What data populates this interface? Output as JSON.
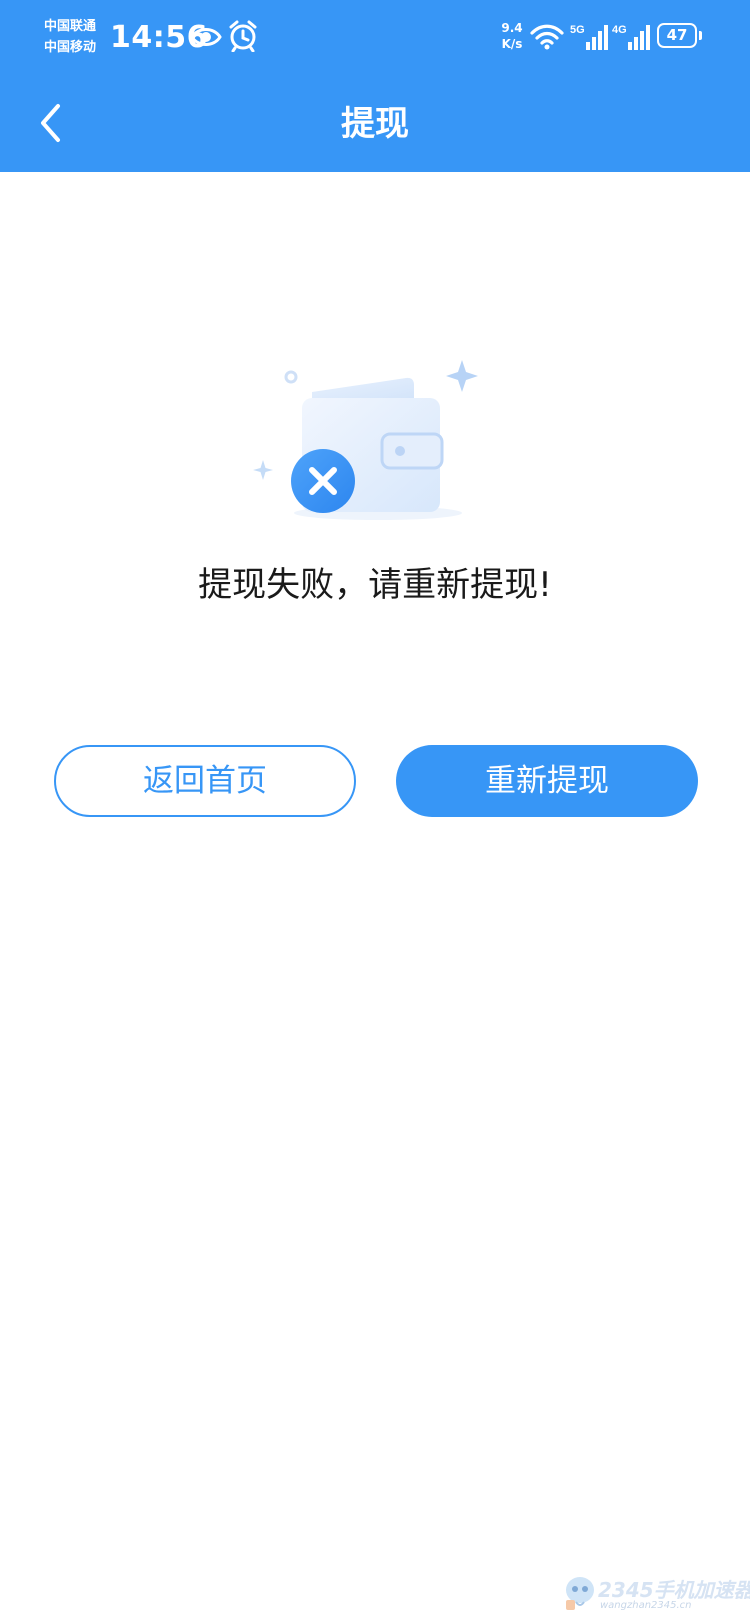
{
  "status_bar": {
    "carrier_1": "中国联通",
    "carrier_2": "中国移动",
    "time": "14:56",
    "net_speed_value": "9.4",
    "net_speed_unit": "K/s",
    "signal_1_label": "5G",
    "signal_2_label": "4G",
    "battery": "47",
    "icons": [
      "eye-icon",
      "alarm-icon",
      "wifi-icon",
      "signal-5g-icon",
      "signal-4g-icon",
      "battery-icon"
    ]
  },
  "nav": {
    "title": "提现",
    "back_icon": "chevron-left-icon"
  },
  "result": {
    "illustration": "wallet-failed-icon",
    "message": "提现失败，请重新提现!"
  },
  "actions": {
    "home_label": "返回首页",
    "retry_label": "重新提现"
  },
  "watermark": {
    "brand": "2345手机加速器",
    "url": "wangzhan2345.cn"
  },
  "colors": {
    "primary": "#3796f6",
    "background": "#ffffff",
    "text": "#1a1a1a"
  }
}
